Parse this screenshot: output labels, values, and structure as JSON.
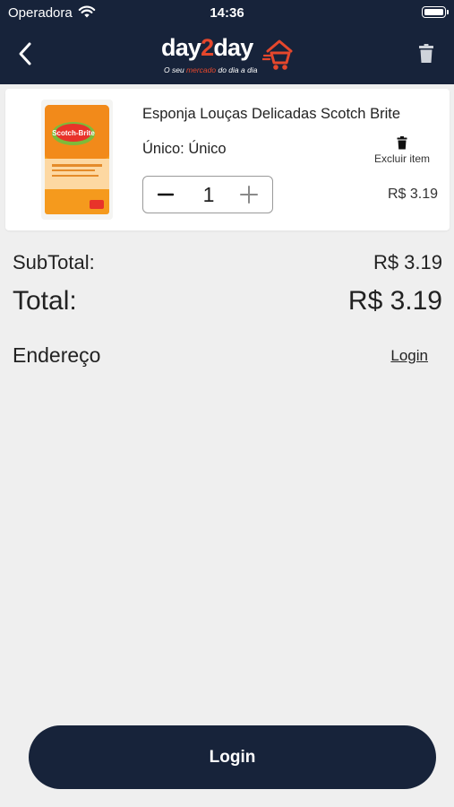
{
  "status_bar": {
    "carrier": "Operadora",
    "time": "14:36"
  },
  "header": {
    "brand": {
      "part1": "day",
      "part2": "2",
      "part3": "day",
      "tagline_a": "O seu ",
      "tagline_b": "mercado",
      "tagline_c": " do dia a dia"
    }
  },
  "cart_item": {
    "name": "Esponja Louças Delicadas Scotch Brite",
    "variant": "Único: Único",
    "remove_label": "Excluir item",
    "quantity": "1",
    "price": "R$ 3.19",
    "image_brand_text": "Scotch-Brite"
  },
  "summary": {
    "subtotal_label": "SubTotal:",
    "subtotal_value": "R$ 3.19",
    "total_label": "Total:",
    "total_value": "R$ 3.19"
  },
  "address": {
    "label": "Endereço",
    "login_link": "Login"
  },
  "footer": {
    "button_label": "Login"
  },
  "colors": {
    "header_bg": "#17233a",
    "accent": "#e5472c",
    "page_bg": "#efefef"
  }
}
